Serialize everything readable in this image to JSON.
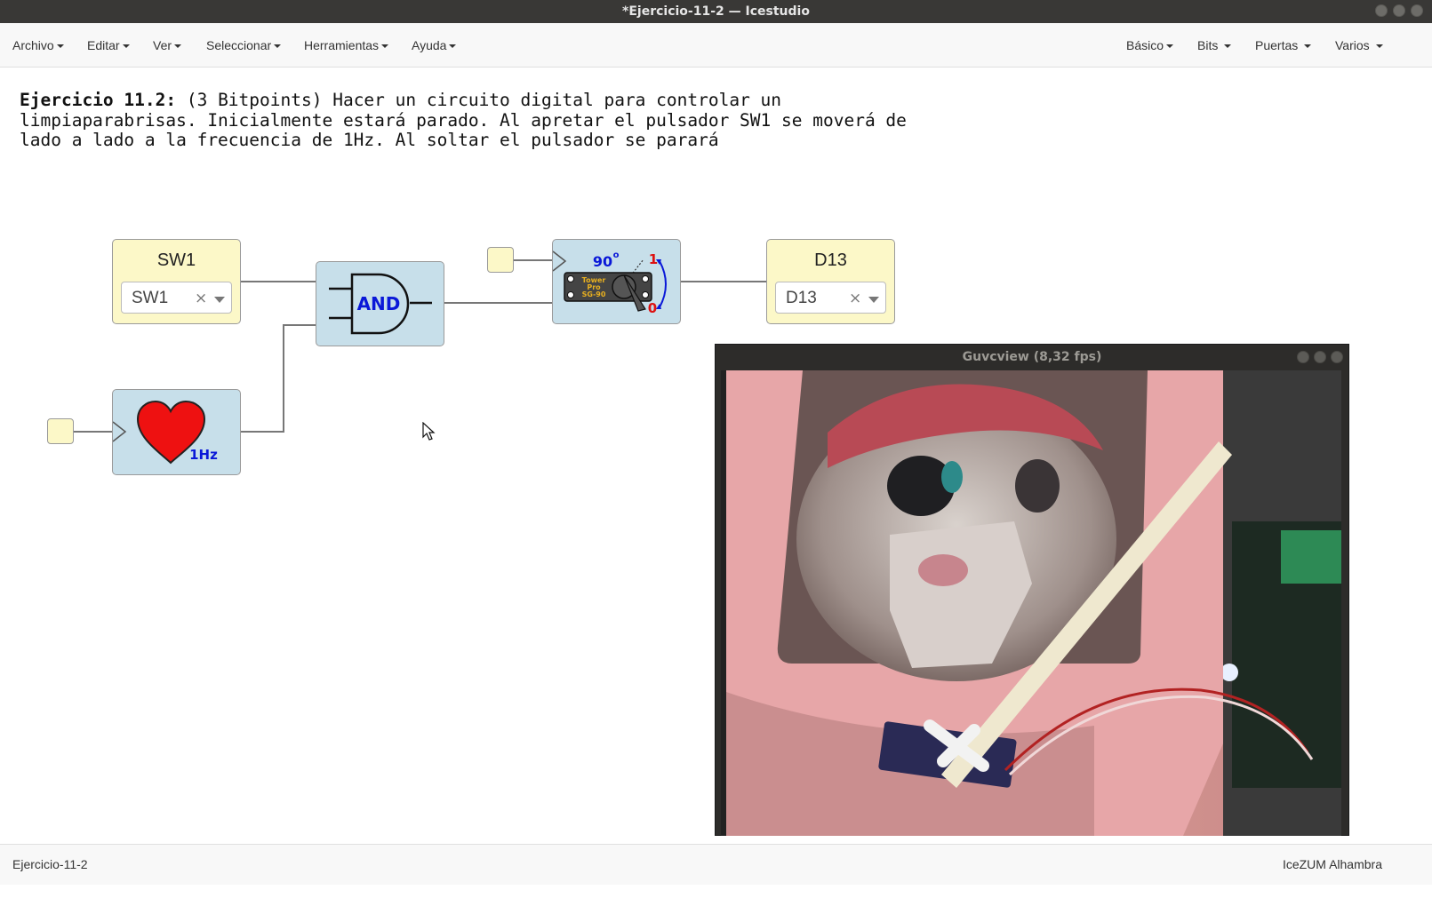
{
  "window": {
    "title": "*Ejercicio-11-2 — Icestudio"
  },
  "menu": {
    "left": [
      "Archivo",
      "Editar",
      "Ver",
      "Seleccionar",
      "Herramientas",
      "Ayuda"
    ],
    "right": [
      "Básico",
      "Bits",
      "Puertas",
      "Varios"
    ]
  },
  "description": {
    "bold": "Ejercicio 11.2:",
    "text": " (3 Bitpoints) Hacer un circuito digital para controlar un\nlimpiaparabrisas. Inicialmente estará parado. Al apretar el pulsador SW1 se moverá de\nlado a lado a la frecuencia de 1Hz. Al soltar el pulsador se parará"
  },
  "blocks": {
    "input": {
      "title": "SW1",
      "value": "SW1",
      "clear": "×"
    },
    "output": {
      "title": "D13",
      "value": "D13",
      "clear": "×"
    },
    "and_gate": {
      "label": "AND"
    },
    "clock": {
      "label": "1Hz"
    },
    "servo": {
      "angle": "90",
      "degree": "o",
      "one": "1",
      "zero": "0",
      "brand_1": "Tower",
      "brand_2": "Pro",
      "model": "SG-90"
    }
  },
  "camera_window": {
    "title": "Guvcview  (8,32 fps)"
  },
  "status": {
    "left": "Ejercicio-11-2",
    "right": "IceZUM Alhambra"
  },
  "colors": {
    "io_block": "#fcf8c8",
    "logic_block": "#c7dfea",
    "heart": "#ee1111",
    "label_blue": "#0a18d8",
    "servo_red": "#dd1111"
  }
}
